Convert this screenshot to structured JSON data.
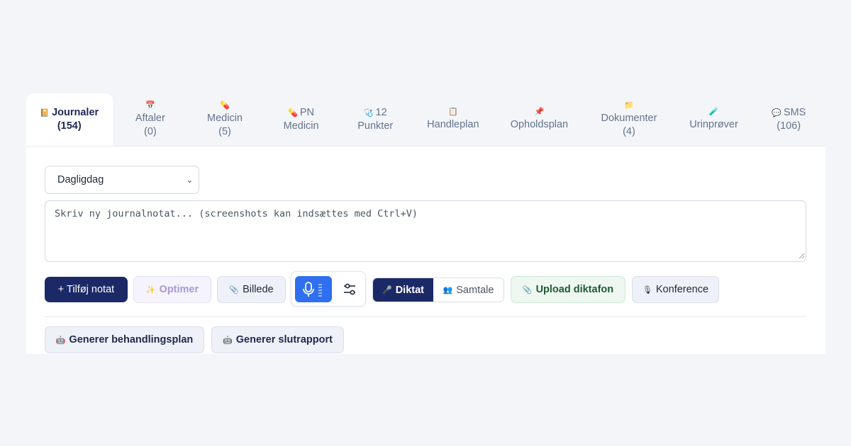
{
  "tabs": [
    {
      "icon": "notebook-icon",
      "emoji": "📔",
      "label": "Journaler",
      "count": "(154)",
      "active": true
    },
    {
      "icon": "calendar-icon",
      "emoji": "📅",
      "label": "Aftaler",
      "count": "(0)"
    },
    {
      "icon": "pill-icon",
      "emoji": "💊",
      "label": "Medicin",
      "count": "(5)"
    },
    {
      "icon": "pill-icon",
      "emoji": "💊",
      "label_line1": "PN",
      "label_line2": "Medicin"
    },
    {
      "icon": "stethoscope-icon",
      "emoji": "🩺",
      "label_line1": "12",
      "label_line2": "Punkter"
    },
    {
      "icon": "clipboard-icon",
      "emoji": "📋",
      "label": "Handleplan"
    },
    {
      "icon": "pushpin-icon",
      "emoji": "📌",
      "label": "Opholdsplan"
    },
    {
      "icon": "folder-icon",
      "emoji": "📁",
      "label": "Dokumenter",
      "count": "(4)"
    },
    {
      "icon": "test-tube-icon",
      "emoji": "🧪",
      "label": "Urinprøver"
    },
    {
      "icon": "speech-bubble-icon",
      "emoji": "💬",
      "label_line1": "SMS",
      "label_line2": "(106)"
    }
  ],
  "category_select": {
    "value": "Dagligdag"
  },
  "note_input": {
    "placeholder": "Skriv ny journalnotat... (screenshots kan indsættes med Ctrl+V)"
  },
  "toolbar": {
    "add_note": "+ Tilføj notat",
    "optimize": "Optimer",
    "optimize_emoji": "✨",
    "image": "Billede",
    "image_emoji": "📎",
    "mode_dictate": "Diktat",
    "mode_dictate_emoji": "🎤",
    "mode_conversation": "Samtale",
    "mode_conversation_emoji": "👥",
    "upload_dictaphone": "Upload diktafon",
    "upload_emoji": "📎",
    "conference": "Konference",
    "conference_emoji": "🎙"
  },
  "actions": {
    "treatment_plan": "Generer behandlingsplan",
    "final_report": "Generer slutrapport",
    "action_emoji": "🤖"
  },
  "colors": {
    "primary": "#1b2a66",
    "mic_blue": "#2f6ff0",
    "background": "#f3f5f9",
    "upload_green_text": "#1f5a34"
  }
}
